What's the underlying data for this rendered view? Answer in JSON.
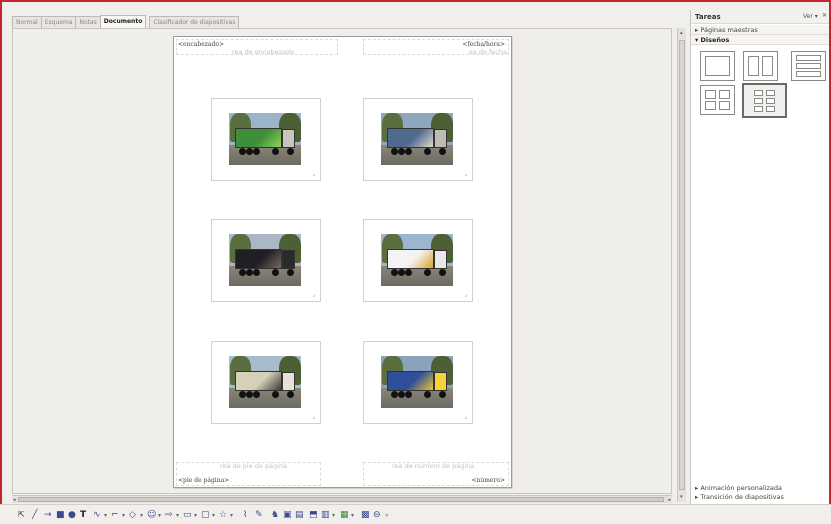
{
  "tabs": [
    {
      "label": "Normal",
      "active": false
    },
    {
      "label": "Esquema",
      "active": false
    },
    {
      "label": "Notas",
      "active": false
    },
    {
      "label": "Documento",
      "active": true
    },
    {
      "label": "Clasificador de diapositivas",
      "active": false
    }
  ],
  "page": {
    "header_label": "<encabezado>",
    "header_ghost": "rea de encabezado",
    "datetime_label": "<fecha/hora>",
    "datetime_ghost": "ea de fecha",
    "footer_label": "<pie de página>",
    "footer_ghost": "rea de pie de página",
    "number_label": "<número>",
    "number_ghost": "rea de número de página"
  },
  "handout_slides": [
    {
      "sky": "#9bb4c9",
      "trailer": "#3f8f3a",
      "accent": "#8fd25a",
      "cab": "#c9c4bc"
    },
    {
      "sky": "#8fa7bd",
      "trailer": "#4f6a8f",
      "accent": "#e0d9c8",
      "cab": "#bfbab2"
    },
    {
      "sky": "#a9b8c4",
      "trailer": "#1f1f24",
      "accent": "#7a6a5c",
      "cab": "#2a2a2a"
    },
    {
      "sky": "#9db6d0",
      "trailer": "#f3f3f3",
      "accent": "#d9a32a",
      "cab": "#e8e8e8"
    },
    {
      "sky": "#a6bccd",
      "trailer": "#d6d0b6",
      "accent": "#3a3a3a",
      "cab": "#e6e2d6"
    },
    {
      "sky": "#8aa3bb",
      "trailer": "#2f4f9a",
      "accent": "#e9c531",
      "cab": "#f4d43a"
    }
  ],
  "taskpane": {
    "title": "Tareas",
    "view_label": "Ver",
    "sections": {
      "master_pages": "Páginas maestras",
      "layouts": "Diseños",
      "custom_animation": "Animación personalizada",
      "slide_transition": "Transición de diapositivas"
    }
  },
  "toolbar": {
    "items": [
      "select-icon",
      "line-icon",
      "arrow-icon",
      "rectangle-icon",
      "ellipse-icon",
      "text-icon",
      "curve-icon",
      "connector-icon",
      "basic-shapes-icon",
      "symbol-shapes-icon",
      "block-arrows-icon",
      "flowchart-icon",
      "callouts-icon",
      "stars-icon",
      "points-icon",
      "glue-points-icon",
      "fontwork-icon",
      "from-file-icon",
      "gallery-icon",
      "extrusion-icon",
      "align-icon",
      "arrange-icon",
      "shadow-icon"
    ]
  },
  "colors": {
    "window_border": "#c0282f",
    "toolbar_icon": "#3a4a8c"
  }
}
